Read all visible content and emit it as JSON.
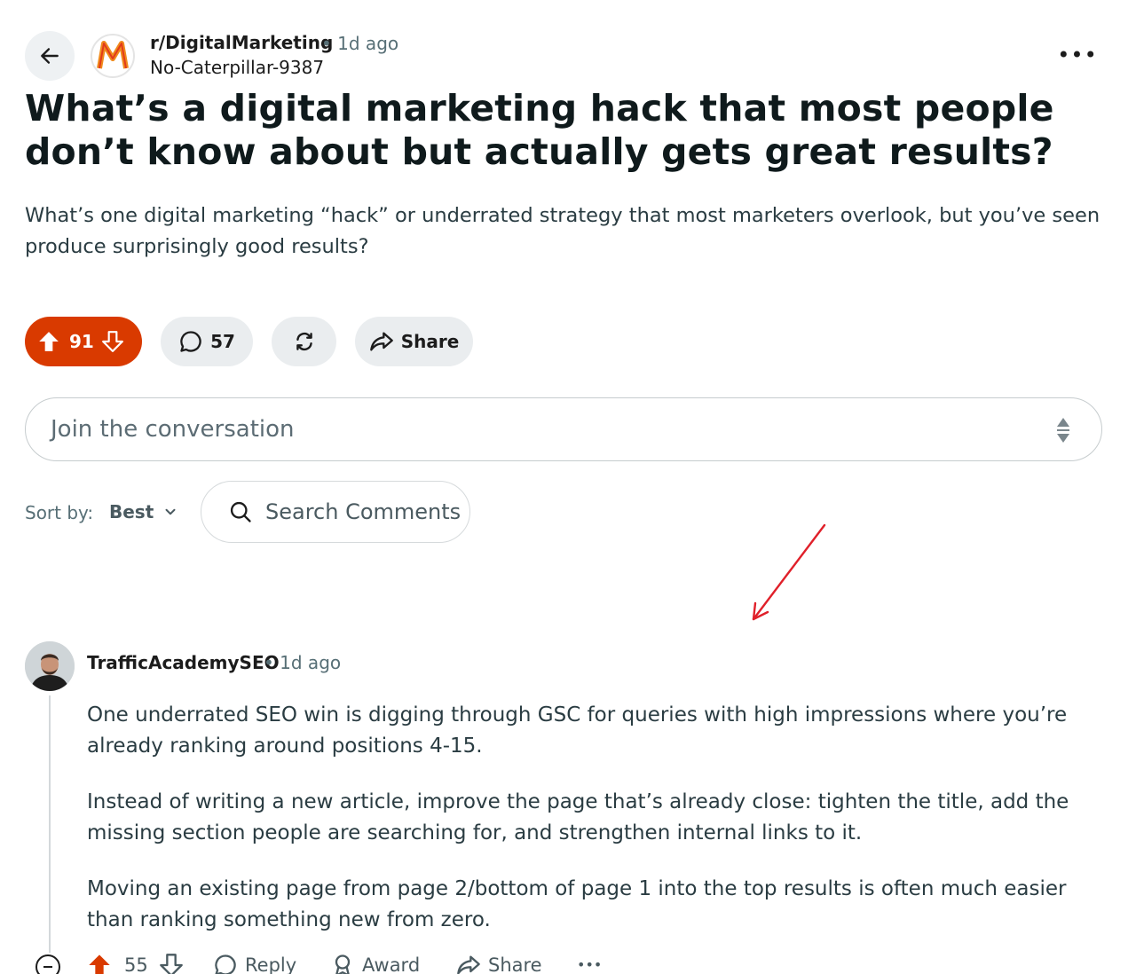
{
  "post": {
    "subreddit": "r/DigitalMarketing",
    "meta": "• 1d ago",
    "author": "No-Caterpillar-9387",
    "title": "What’s a digital marketing hack that most people don’t know about but actually gets great results?",
    "body": "What’s one digital marketing “hack” or underrated strategy that most marketers overlook, but you’ve seen produce surprisingly good results?",
    "votes": "91",
    "comments": "57",
    "share_label": "Share",
    "more": "•••"
  },
  "composer": {
    "placeholder": "Join the conversation"
  },
  "sort": {
    "label": "Sort by:",
    "value": "Best",
    "search_placeholder": "Search Comments"
  },
  "comment": {
    "author": "TrafficAcademySEO",
    "meta": "• 1d ago",
    "paragraphs": [
      "One underrated SEO win is digging through GSC for queries with high impressions where you’re already ranking around positions 4-15.",
      "Instead of writing a new article, improve the page that’s already close: tighten the title, add the missing section people are searching for, and strengthen internal links to it.",
      "Moving an existing page from page 2/bottom of page 1 into the top results is often much easier than ranking something new from zero."
    ],
    "votes": "55",
    "reply_label": "Reply",
    "award_label": "Award",
    "share_label": "Share",
    "more": "•••"
  },
  "colors": {
    "upvote_accent": "#d93a00",
    "pill_bg": "#eaedef",
    "annotation_arrow": "#e0202a"
  }
}
